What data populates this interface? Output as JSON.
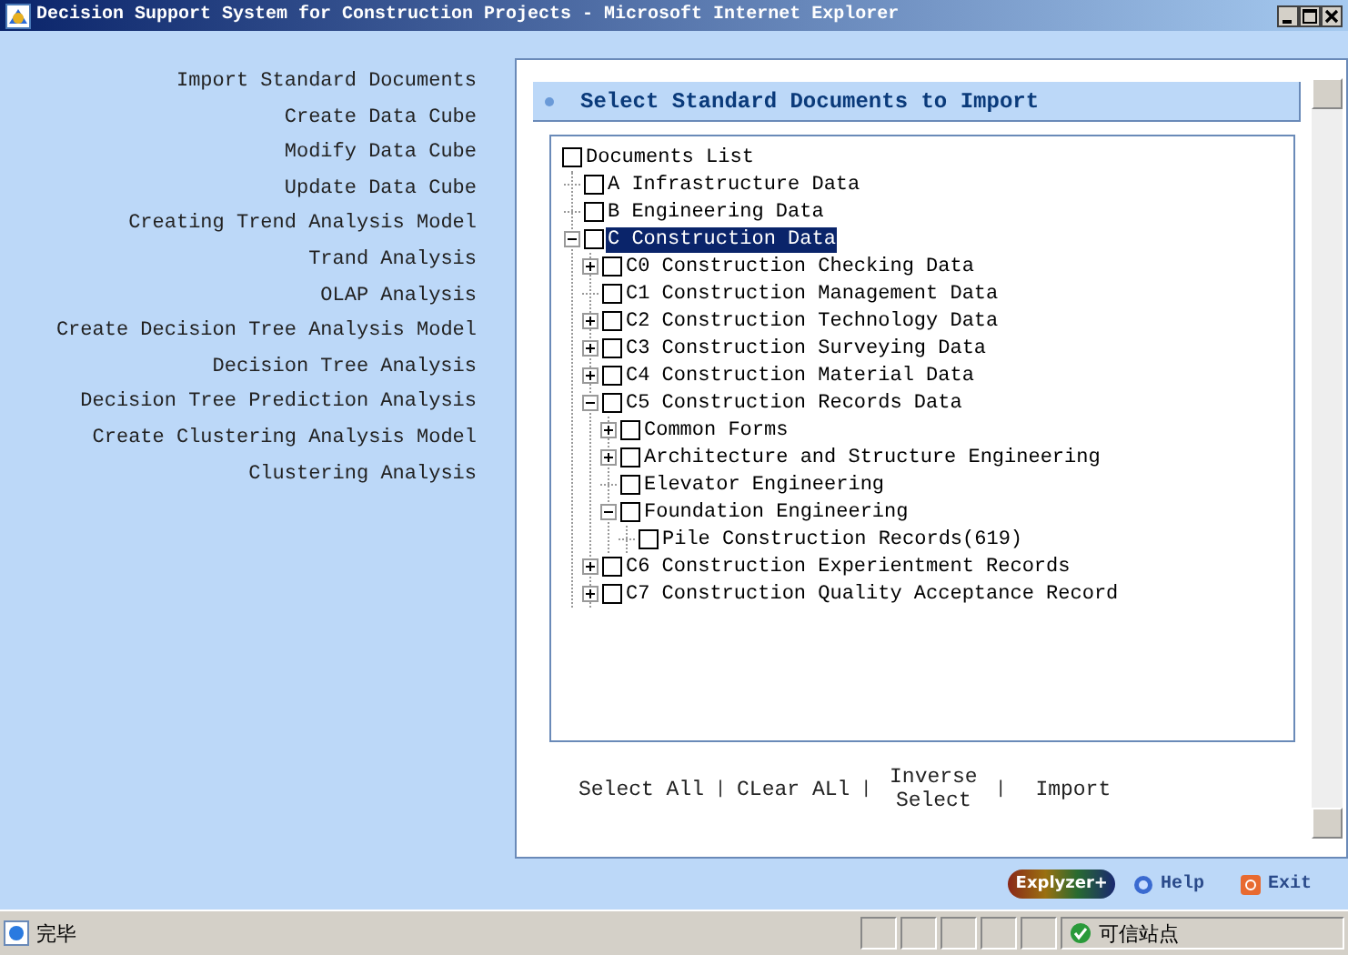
{
  "window": {
    "title": "Decision Support System for Construction Projects - Microsoft Internet Explorer"
  },
  "sidebar": {
    "items": [
      {
        "label": "Import Standard Documents"
      },
      {
        "label": "Create Data Cube"
      },
      {
        "label": "Modify Data Cube"
      },
      {
        "label": "Update Data Cube"
      },
      {
        "label": "Creating Trend Analysis Model"
      },
      {
        "label": "Trand Analysis"
      },
      {
        "label": "OLAP Analysis"
      },
      {
        "label": "Create Decision Tree Analysis Model"
      },
      {
        "label": "Decision Tree Analysis"
      },
      {
        "label": "Decision Tree Prediction Analysis"
      },
      {
        "label": "Create Clustering Analysis Model"
      },
      {
        "label": "Clustering Analysis"
      }
    ]
  },
  "panel": {
    "heading": "Select Standard Documents to Import",
    "tree": {
      "label": "Documents List",
      "kind": "root",
      "checked": false,
      "selected": false,
      "children": [
        {
          "label": "A Infrastructure Data",
          "kind": "leaf",
          "checked": false,
          "selected": false
        },
        {
          "label": "B Engineering Data",
          "kind": "leaf",
          "checked": false,
          "selected": false
        },
        {
          "label": "C Construction Data",
          "kind": "branch",
          "expanded": true,
          "checked": false,
          "selected": true,
          "children": [
            {
              "label": "C0 Construction Checking Data",
              "kind": "branch",
              "expanded": false,
              "checked": false,
              "selected": false
            },
            {
              "label": "C1 Construction Management Data",
              "kind": "leaf",
              "checked": false,
              "selected": false
            },
            {
              "label": "C2 Construction Technology Data",
              "kind": "branch",
              "expanded": false,
              "checked": false,
              "selected": false
            },
            {
              "label": "C3 Construction Surveying Data",
              "kind": "branch",
              "expanded": false,
              "checked": false,
              "selected": false
            },
            {
              "label": "C4 Construction Material Data",
              "kind": "branch",
              "expanded": false,
              "checked": false,
              "selected": false
            },
            {
              "label": "C5 Construction Records Data",
              "kind": "branch",
              "expanded": true,
              "checked": false,
              "selected": false,
              "children": [
                {
                  "label": "Common Forms",
                  "kind": "branch",
                  "expanded": false,
                  "checked": false,
                  "selected": false
                },
                {
                  "label": "Architecture and Structure Engineering",
                  "kind": "branch",
                  "expanded": false,
                  "checked": false,
                  "selected": false
                },
                {
                  "label": "Elevator Engineering",
                  "kind": "leaf",
                  "checked": false,
                  "selected": false
                },
                {
                  "label": "Foundation Engineering",
                  "kind": "branch",
                  "expanded": true,
                  "checked": false,
                  "selected": false,
                  "children": [
                    {
                      "label": "Pile Construction Records(619)",
                      "kind": "leaf",
                      "checked": false,
                      "selected": false
                    }
                  ]
                }
              ]
            },
            {
              "label": "C6 Construction Experientment Records",
              "kind": "branch",
              "expanded": false,
              "checked": false,
              "selected": false
            },
            {
              "label": "C7 Construction Quality Acceptance Record",
              "kind": "branch",
              "expanded": false,
              "checked": false,
              "selected": false
            }
          ]
        }
      ]
    },
    "actions": [
      {
        "label": "Select All"
      },
      {
        "label": "CLear ALl"
      },
      {
        "label": "Inverse Select"
      },
      {
        "label": "Import"
      }
    ],
    "separator": "|"
  },
  "footer": {
    "logo": "Explyzer+",
    "links": [
      {
        "label": "Help",
        "kind": "help"
      },
      {
        "label": "Exit",
        "kind": "exit"
      }
    ]
  },
  "status_bar": {
    "text": "完毕",
    "zone": "可信站点"
  }
}
